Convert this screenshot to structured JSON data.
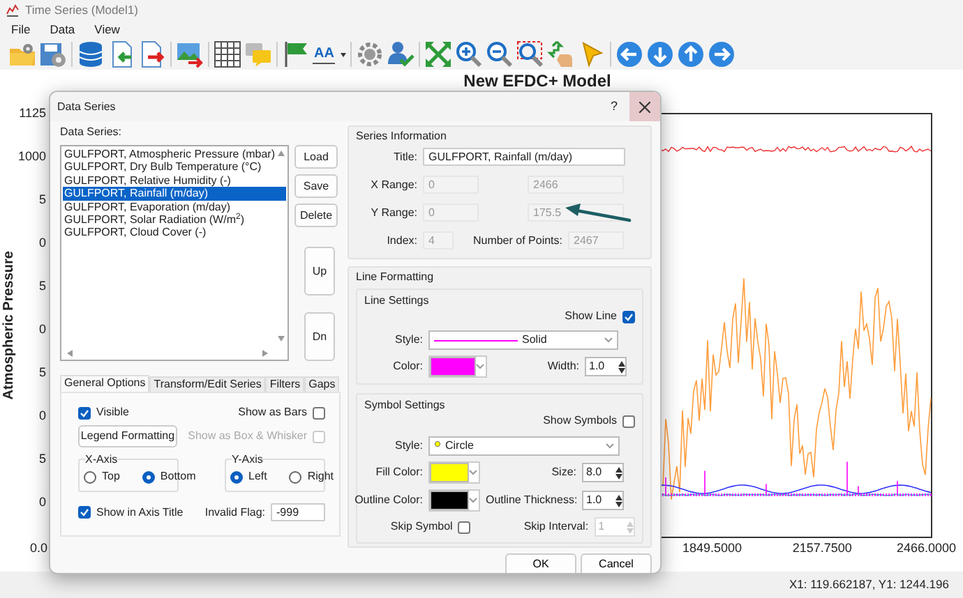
{
  "window": {
    "title": "Time Series (Model1)"
  },
  "menu": [
    "File",
    "Data",
    "View"
  ],
  "toolbar": {
    "font_button": "AA"
  },
  "chart": {
    "title": "New EFDC+ Model",
    "ylabel": "Atmospheric Pressure",
    "y_tick_labels": [
      "1125",
      "1000",
      "5",
      "0",
      "5",
      "0",
      "5",
      "0",
      "5",
      "0"
    ],
    "x_tick_labels": [
      "0.0",
      "1849.5000",
      "2157.7500",
      "2466.0000"
    ]
  },
  "dialog": {
    "title": "Data Series",
    "help": "?",
    "series_label": "Data Series:",
    "series": [
      {
        "label": "GULFPORT, Atmospheric Pressure (mbar)",
        "selected": false
      },
      {
        "label": "GULFPORT, Dry Bulb Temperature (°C)",
        "selected": false
      },
      {
        "label": "GULFPORT, Relative Humidity (-)",
        "selected": false
      },
      {
        "label": "GULFPORT, Rainfall (m/day)",
        "selected": true
      },
      {
        "label": "GULFPORT, Evaporation (m/day)",
        "selected": false
      },
      {
        "label": "GULFPORT, Solar Radiation (W/m$^{2}$)",
        "selected": false
      },
      {
        "label": "GULFPORT, Cloud Cover (-)",
        "selected": false
      }
    ],
    "list_buttons": [
      "Load",
      "Save",
      "Delete"
    ],
    "order_buttons": [
      "Up",
      "Dn"
    ],
    "tabs": [
      {
        "label": "General Options",
        "selected": true
      },
      {
        "label": "Transform/Edit Series",
        "selected": false
      },
      {
        "label": "Filters",
        "selected": false
      },
      {
        "label": "Gaps",
        "selected": false
      }
    ],
    "general": {
      "visible": {
        "label": "Visible",
        "checked": true
      },
      "show_as_bars": {
        "label": "Show as Bars",
        "checked": false
      },
      "legend_button": "Legend Formatting",
      "box_whisker": {
        "label": "Show as Box & Whisker",
        "checked": false,
        "disabled": true
      },
      "x_axis": {
        "label": "X-Axis",
        "options": [
          {
            "label": "Top",
            "selected": false
          },
          {
            "label": "Bottom",
            "selected": true
          }
        ]
      },
      "y_axis": {
        "label": "Y-Axis",
        "options": [
          {
            "label": "Left",
            "selected": true
          },
          {
            "label": "Right",
            "selected": false
          }
        ]
      },
      "show_in_axis_title": {
        "label": "Show in Axis Title",
        "checked": true
      },
      "invalid_flag": {
        "label": "Invalid Flag:",
        "value": "-999"
      }
    },
    "series_info": {
      "heading": "Series Information",
      "title": {
        "label": "Title:",
        "value": "GULFPORT, Rainfall (m/day)"
      },
      "x_range": {
        "label": "X Range:",
        "min": "0",
        "max": "2466"
      },
      "y_range": {
        "label": "Y Range:",
        "min": "0",
        "max": "175.5"
      },
      "index": {
        "label": "Index:",
        "value": "4"
      },
      "points": {
        "label": "Number of Points:",
        "value": "2467"
      }
    },
    "line_formatting": {
      "heading": "Line Formatting",
      "line_settings": {
        "heading": "Line Settings",
        "show": {
          "label": "Show Line",
          "checked": true
        },
        "style": {
          "label": "Style:",
          "value": "Solid"
        },
        "color": {
          "label": "Color:",
          "color": "#ff00ff"
        },
        "width": {
          "label": "Width:",
          "value": "1.0"
        }
      },
      "symbol_settings": {
        "heading": "Symbol Settings",
        "show": {
          "label": "Show Symbols",
          "checked": false
        },
        "style": {
          "label": "Style:",
          "value": "Circle"
        },
        "fill_color": {
          "label": "Fill Color:",
          "color": "#ffff00"
        },
        "size": {
          "label": "Size:",
          "value": "8.0"
        },
        "outline_color": {
          "label": "Outline Color:",
          "color": "#000000"
        },
        "outline_thickness": {
          "label": "Outline Thickness:",
          "value": "1.0"
        },
        "skip_symbol": {
          "label": "Skip Symbol",
          "checked": false
        },
        "skip_interval": {
          "label": "Skip Interval:",
          "value": "1",
          "disabled": true
        }
      }
    },
    "buttons": [
      "OK",
      "Cancel"
    ]
  },
  "status_bar": "X1: 119.662187, Y1: 1244.196"
}
